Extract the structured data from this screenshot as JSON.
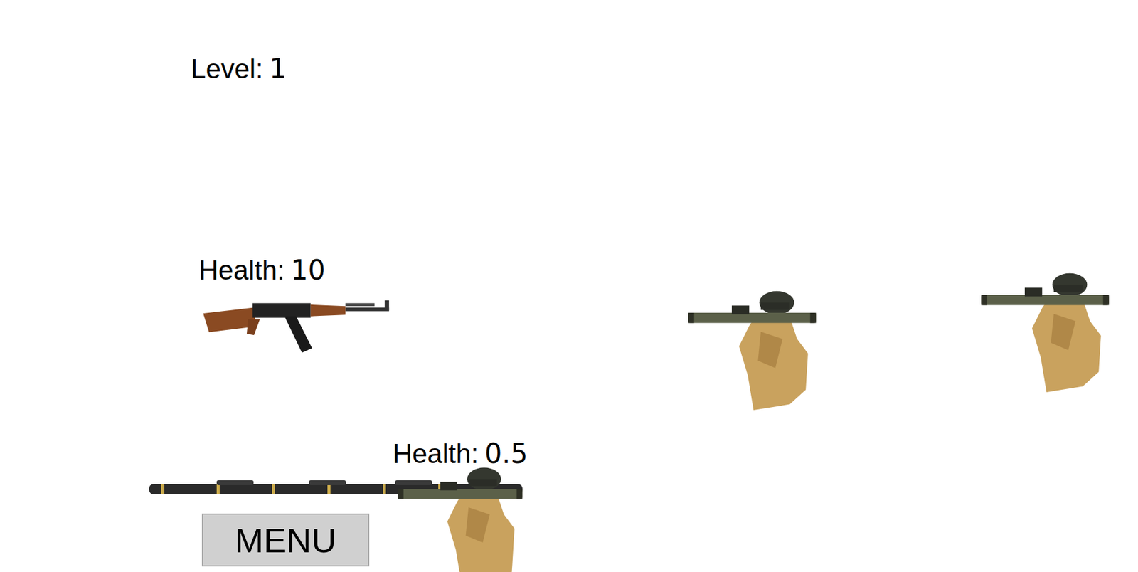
{
  "hud": {
    "level_label": "Level:",
    "level_value": "1"
  },
  "player": {
    "health_label": "Health:",
    "health_value": "10"
  },
  "enemy": {
    "health_label": "Health:",
    "health_value": "0.5"
  },
  "menu_button": {
    "label": "MENU"
  }
}
